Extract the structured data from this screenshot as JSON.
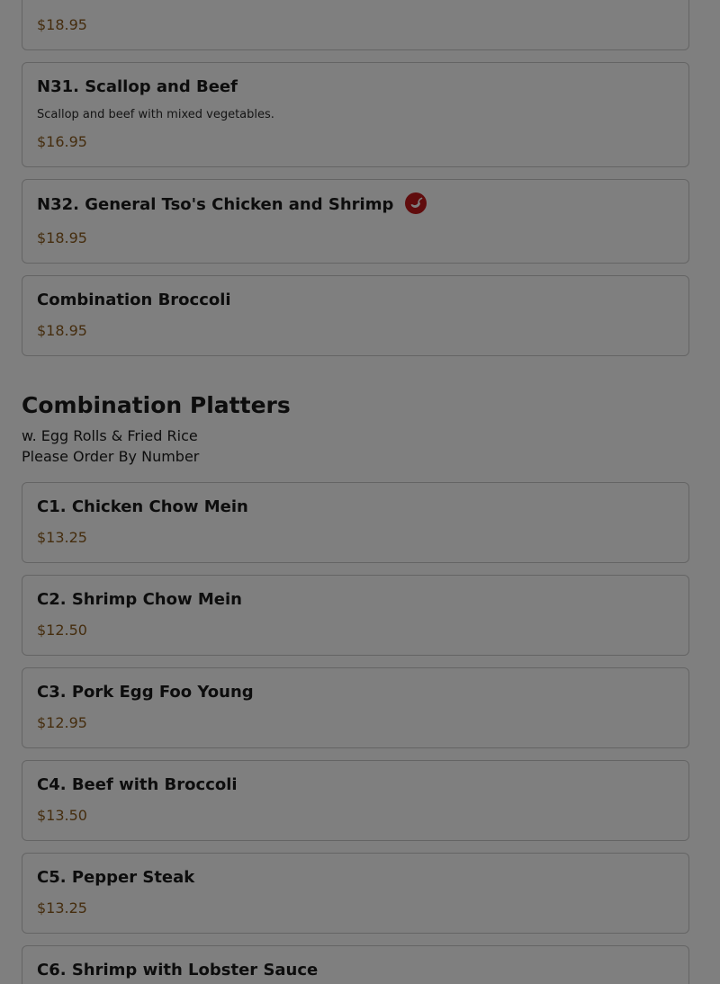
{
  "top_card": {
    "price": "$18.95"
  },
  "items_first": [
    {
      "name": "N31. Scallop and Beef",
      "description": "Scallop and beef with mixed vegetables.",
      "price": "$16.95"
    },
    {
      "name": "N32. General Tso's Chicken and Shrimp",
      "price": "$18.95",
      "icon": "spicy-pepper-icon"
    },
    {
      "name": "Combination Broccoli",
      "price": "$18.95"
    }
  ],
  "section": {
    "title": "Combination Platters",
    "subtitle_1": "w. Egg Rolls & Fried Rice",
    "subtitle_2": "Please Order By Number"
  },
  "combo_items": [
    {
      "name": "C1. Chicken Chow Mein",
      "price": "$13.25"
    },
    {
      "name": "C2. Shrimp Chow Mein",
      "price": "$12.50"
    },
    {
      "name": "C3. Pork Egg Foo Young",
      "price": "$12.95"
    },
    {
      "name": "C4. Beef with Broccoli",
      "price": "$13.50"
    },
    {
      "name": "C5. Pepper Steak",
      "price": "$13.25"
    },
    {
      "name": "C6. Shrimp with Lobster Sauce"
    }
  ],
  "colors": {
    "price": "#8a5a1c",
    "spicy": "#c0181b",
    "border": "#c9c9c9",
    "overlay": "rgba(0,0,0,0.5)"
  }
}
